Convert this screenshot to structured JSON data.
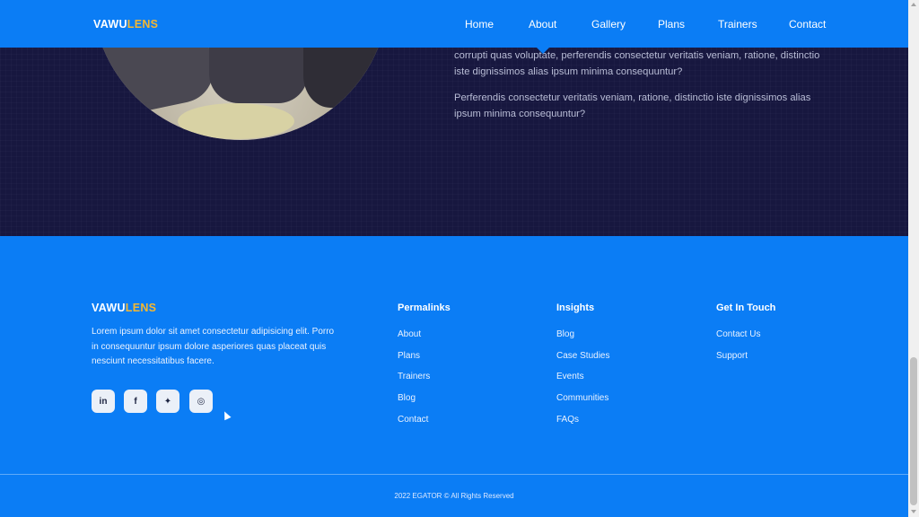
{
  "brand": {
    "part1": "VAWU",
    "part2": "LENS"
  },
  "nav": {
    "items": [
      {
        "label": "Home"
      },
      {
        "label": "About"
      },
      {
        "label": "Gallery"
      },
      {
        "label": "Plans"
      },
      {
        "label": "Trainers"
      },
      {
        "label": "Contact"
      }
    ],
    "active": "About"
  },
  "about": {
    "paragraph1": "corrupti quas voluptate, perferendis consectetur veritatis veniam, ratione, distinctio iste dignissimos alias ipsum minima consequuntur?",
    "paragraph2": "Perferendis consectetur veritatis veniam, ratione, distinctio iste dignissimos alias ipsum minima consequuntur?"
  },
  "footer": {
    "description": "Lorem ipsum dolor sit amet consectetur adipisicing elit. Porro in consequuntur ipsum dolore asperiores quas placeat quis nesciunt necessitatibus facere.",
    "social": [
      {
        "icon": "linkedin-icon",
        "glyph": "in"
      },
      {
        "icon": "facebook-icon",
        "glyph": "f"
      },
      {
        "icon": "twitter-icon",
        "glyph": "✦"
      },
      {
        "icon": "instagram-icon",
        "glyph": "◎"
      }
    ],
    "columns": [
      {
        "title": "Permalinks",
        "links": [
          "About",
          "Plans",
          "Trainers",
          "Blog",
          "Contact"
        ]
      },
      {
        "title": "Insights",
        "links": [
          "Blog",
          "Case Studies",
          "Events",
          "Communities",
          "FAQs"
        ]
      },
      {
        "title": "Get In Touch",
        "links": [
          "Contact Us",
          "Support"
        ]
      }
    ],
    "copyright": "2022 EGATOR © All Rights Reserved"
  },
  "colors": {
    "primary": "#0b7df5",
    "dark": "#17173f",
    "accent": "#f5b731"
  }
}
